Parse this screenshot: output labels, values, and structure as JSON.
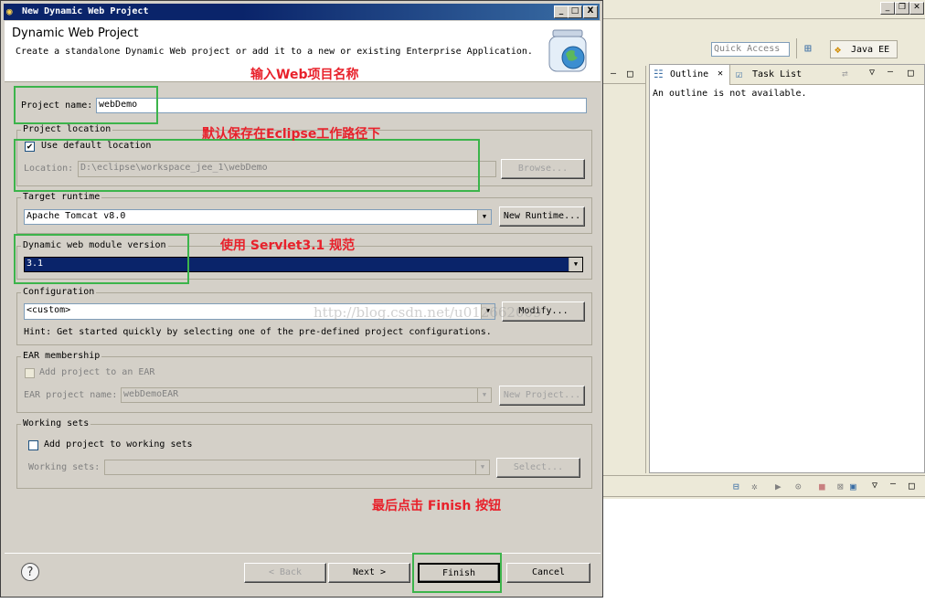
{
  "dialog": {
    "title": "New Dynamic Web Project",
    "window_controls": [
      "_",
      "□",
      "X"
    ],
    "header_title": "Dynamic Web Project",
    "header_description": "Create a standalone Dynamic Web project or add it to a new or existing Enterprise Application.",
    "project_name_label": "Project name:",
    "project_name_value": "webDemo",
    "project_location": {
      "group_label": "Project location",
      "use_default_label": "Use default location",
      "use_default_checked": true,
      "location_label": "Location:",
      "location_value": "D:\\eclipse\\workspace_jee_1\\webDemo",
      "browse_label": "Browse..."
    },
    "target_runtime": {
      "group_label": "Target runtime",
      "value": "Apache Tomcat v8.0",
      "new_runtime_label": "New Runtime..."
    },
    "module_version": {
      "group_label": "Dynamic web module version",
      "value": "3.1"
    },
    "configuration": {
      "group_label": "Configuration",
      "value": "<custom>",
      "modify_label": "Modify...",
      "hint": "Hint: Get started quickly by selecting one of the pre-defined project configurations."
    },
    "ear_membership": {
      "group_label": "EAR membership",
      "add_label": "Add project to an EAR",
      "ear_name_label": "EAR project name:",
      "ear_name_value": "webDemoEAR",
      "new_project_label": "New Project..."
    },
    "working_sets": {
      "group_label": "Working sets",
      "add_label": "Add project to working sets",
      "sets_label": "Working sets:",
      "select_label": "Select..."
    },
    "buttons": {
      "back": "< Back",
      "next": "Next >",
      "finish": "Finish",
      "cancel": "Cancel"
    }
  },
  "annotations": {
    "name_note": "输入Web项目名称",
    "location_note": "默认保存在Eclipse工作路径下",
    "version_note": "使用 Servlet3.1 规范",
    "finish_note": "最后点击 Finish 按钮"
  },
  "watermark": "http://blog.csdn.net/u012662009",
  "eclipse": {
    "quick_access_placeholder": "Quick Access",
    "perspective_label": "Java EE",
    "outline_tab": "Outline",
    "task_list_tab": "Task List",
    "outline_message": "An outline is not available."
  },
  "colors": {
    "annotation_red": "#e8212b",
    "highlight_green": "#3cb44b",
    "selection_navy": "#0a246a"
  }
}
